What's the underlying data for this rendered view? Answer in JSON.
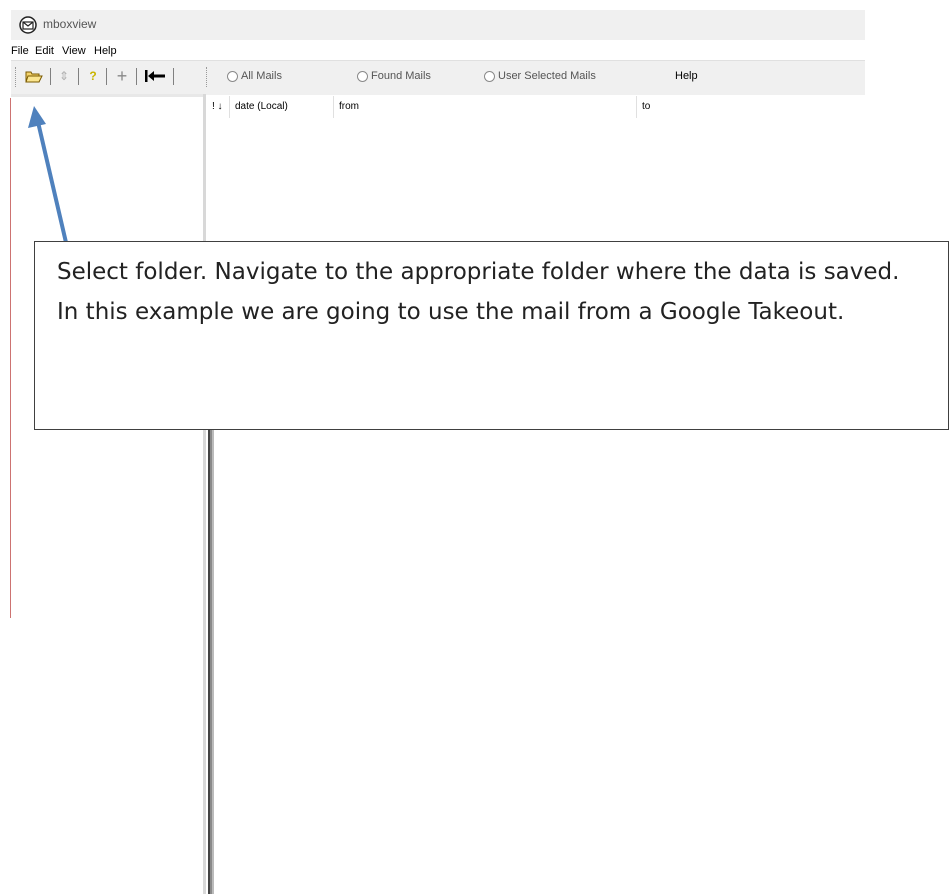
{
  "window": {
    "title": "mboxview",
    "icon": "envelope-app-icon"
  },
  "menu": {
    "items": [
      "File",
      "Edit",
      "View",
      "Help"
    ]
  },
  "toolbar": {
    "buttons": [
      {
        "icon": "open-folder-icon",
        "glyph": "📂"
      },
      {
        "icon": "refresh-icon",
        "glyph": "⇕"
      },
      {
        "icon": "question-icon",
        "glyph": "?"
      },
      {
        "icon": "plus-icon",
        "glyph": "+"
      },
      {
        "icon": "collapse-left-icon",
        "glyph": "⇤"
      }
    ],
    "radios": [
      "All Mails",
      "Found Mails",
      "User Selected Mails"
    ],
    "help_label": "Help"
  },
  "list": {
    "columns": [
      "! ↓",
      "date (Local)",
      "from",
      "to"
    ]
  },
  "callout": {
    "text": "Select folder. Navigate to the appropriate folder where the data is saved. In this example we are going to use the mail from a Google Takeout."
  },
  "colors": {
    "arrow": "#4f81bd",
    "toolbar_bg": "#f0f0f0"
  }
}
